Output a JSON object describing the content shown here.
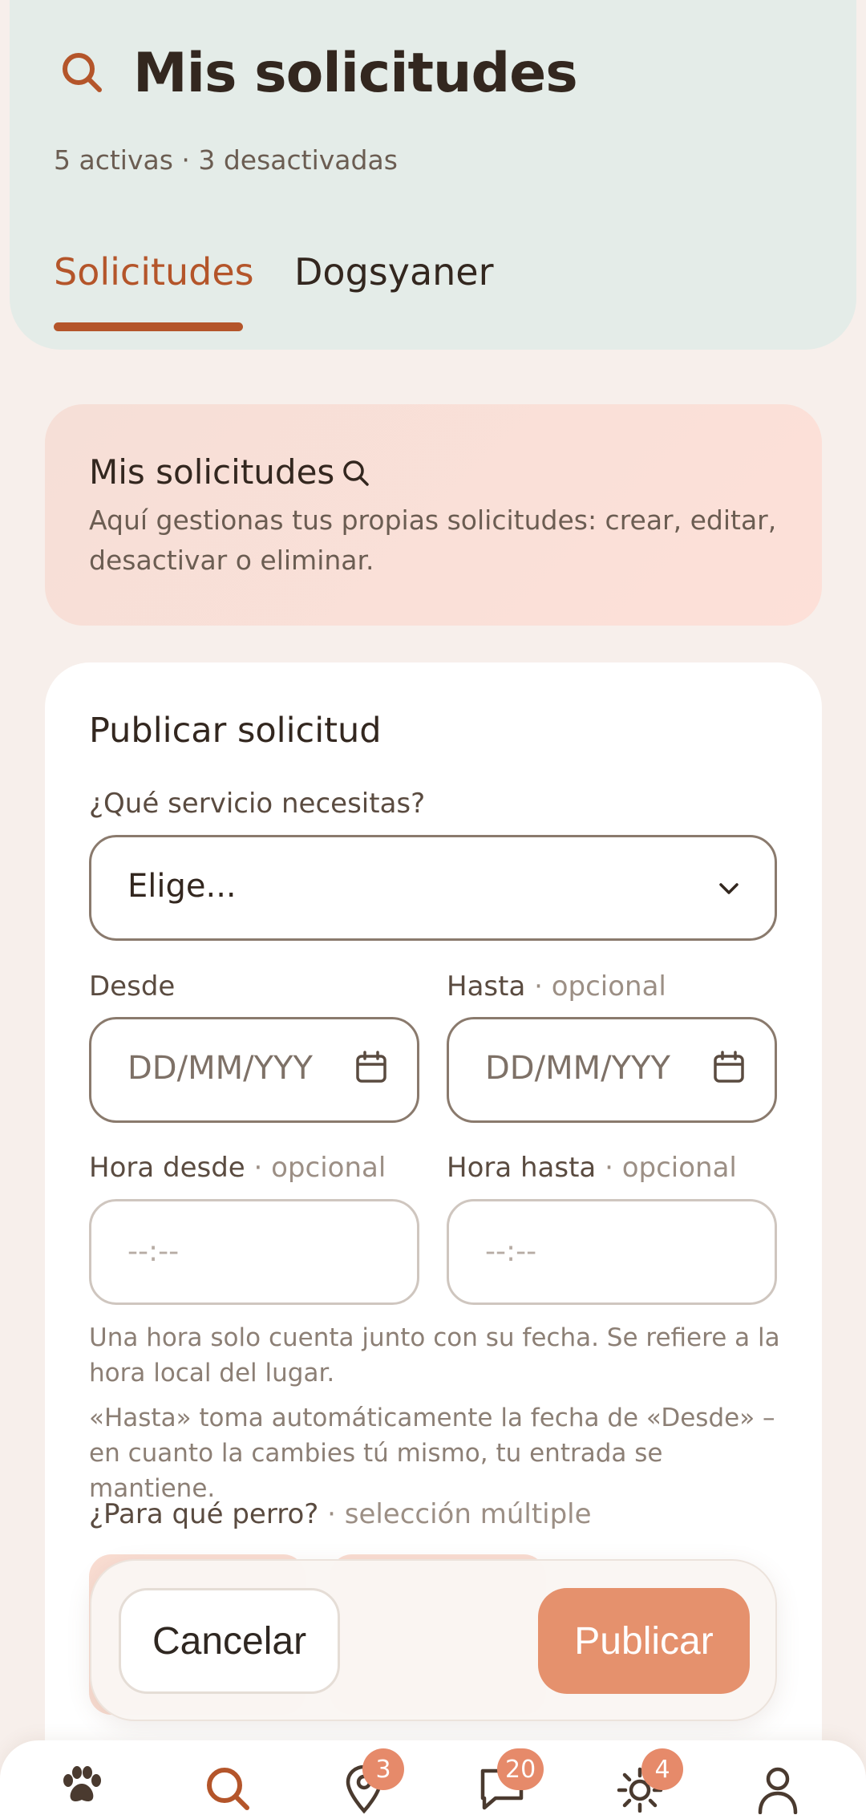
{
  "header": {
    "title": "Mis solicitudes",
    "subtitle": "5 activas · 3 desactivadas",
    "tabs": [
      {
        "label": "Solicitudes",
        "active": true
      },
      {
        "label": "Dogsyaner",
        "active": false
      }
    ]
  },
  "info": {
    "title": "Mis solicitudes",
    "description": "Aquí gestionas tus propias solicitudes: crear, editar, desactivar o eliminar."
  },
  "form": {
    "title": "Publicar solicitud",
    "service_label": "¿Qué servicio necesitas?",
    "service_value": "Elige...",
    "from_label": "Desde",
    "to_label": "Hasta",
    "optional": "· opcional",
    "date_placeholder": "DD/MM/YYY",
    "time_from_label": "Hora desde",
    "time_to_label": "Hora hasta",
    "time_placeholder": "--:--",
    "help_1": "Una hora solo cuenta junto con su fecha. Se refiere a la hora local del lugar.",
    "help_2": "«Hasta» toma automáticamente la fecha de «Desde» – en cuanto la cambies tú mismo, tu entrada se mantiene.",
    "dog_label": "¿Para qué perro?",
    "dog_hint": "· selección múltiple"
  },
  "actions": {
    "cancel": "Cancelar",
    "publish": "Publicar"
  },
  "nav": {
    "items": [
      {
        "icon": "paw-icon"
      },
      {
        "icon": "search-icon",
        "active": true
      },
      {
        "icon": "location-pin-icon",
        "badge": "3"
      },
      {
        "icon": "chat-icon",
        "badge": "20"
      },
      {
        "icon": "sun-icon",
        "badge": "4"
      },
      {
        "icon": "user-icon"
      }
    ]
  },
  "colors": {
    "accent": "#b4552a",
    "publish": "#e5916d",
    "badge": "#e68a6a",
    "header_bg": "#e4ece8"
  }
}
